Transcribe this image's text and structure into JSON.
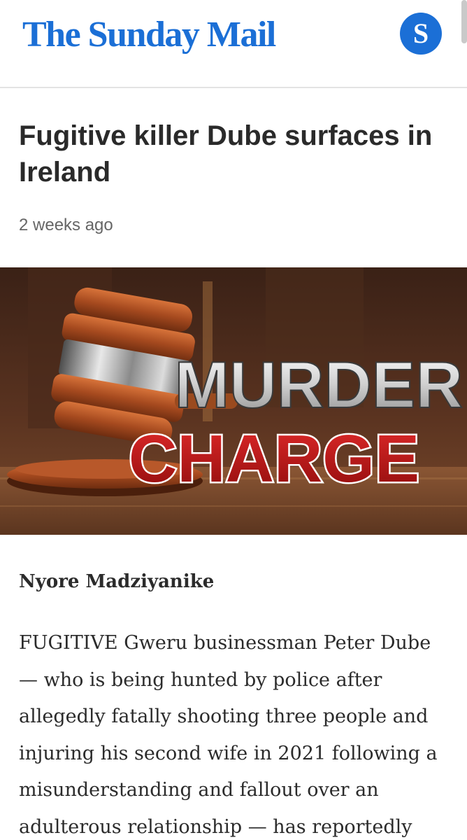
{
  "header": {
    "logo": "The Sunday Mail",
    "avatar_letter": "S"
  },
  "article": {
    "headline": "Fugitive killer Dube surfaces in Ireland",
    "timestamp": "2 weeks ago",
    "image": {
      "line1": "MURDER",
      "line2": "CHARGE"
    },
    "byline": "Nyore Madziyanike",
    "body": "FUGITIVE Gweru businessman Peter Dube — who is being hunted by police after allegedly fatally shooting three people and injuring his second wife in 2021 following a misunderstanding and fallout over an adulterous relationship — has reportedly"
  },
  "colors": {
    "brand": "#1b6fd6",
    "headline": "#2a2a2a",
    "timestamp": "#666666",
    "charge_red": "#c4161c"
  }
}
